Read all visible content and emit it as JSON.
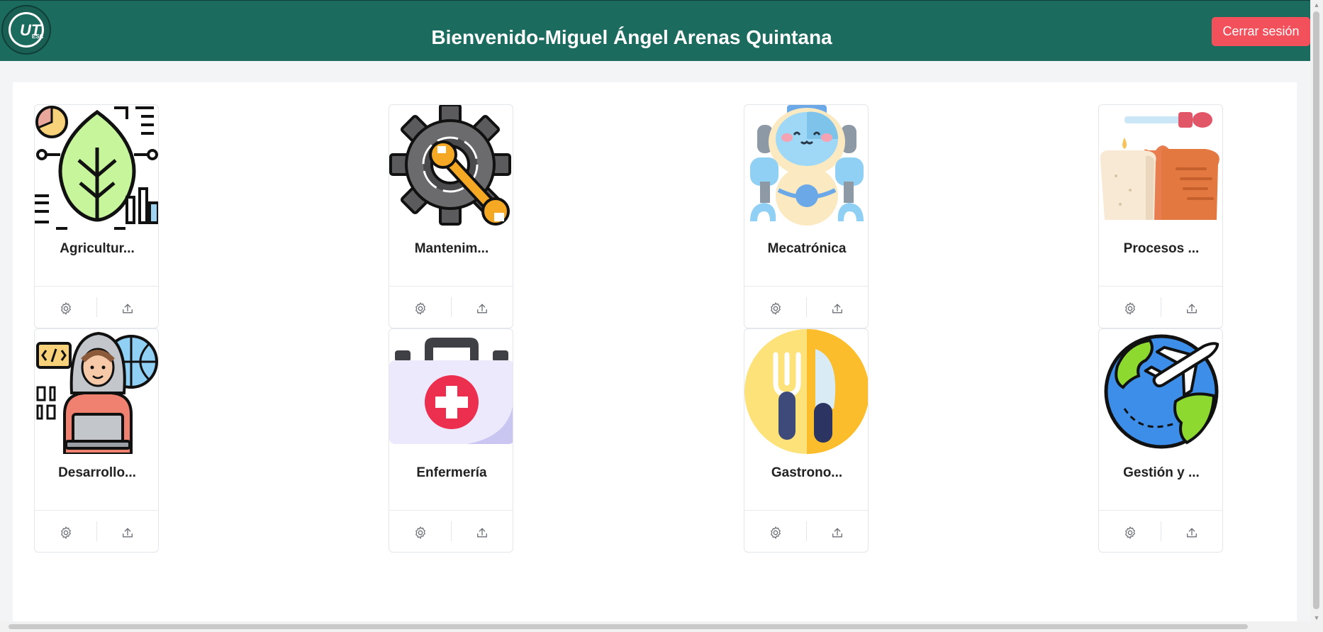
{
  "header": {
    "title": "Bienvenido-Miguel Ángel Arenas Quintana",
    "logo_text": "UT",
    "logo_sub": "ESC",
    "logout_label": "Cerrar sesión",
    "bg_color": "#1c6b5f",
    "logout_color": "#f2505b"
  },
  "cards": [
    {
      "name": "Agricultur...",
      "icon": "leaf-icon"
    },
    {
      "name": "Mantenim...",
      "icon": "gear-wrench-icon"
    },
    {
      "name": "Mecatrónica",
      "icon": "robot-icon"
    },
    {
      "name": "Procesos ...",
      "icon": "bread-dropper-icon"
    },
    {
      "name": "Desarrollo...",
      "icon": "developer-icon"
    },
    {
      "name": "Enfermería",
      "icon": "first-aid-kit-icon"
    },
    {
      "name": "Gastrono...",
      "icon": "fork-knife-icon"
    },
    {
      "name": "Gestión y ...",
      "icon": "globe-airplane-icon"
    }
  ],
  "card_actions": {
    "settings_icon": "gear-icon",
    "upload_icon": "upload-icon"
  }
}
